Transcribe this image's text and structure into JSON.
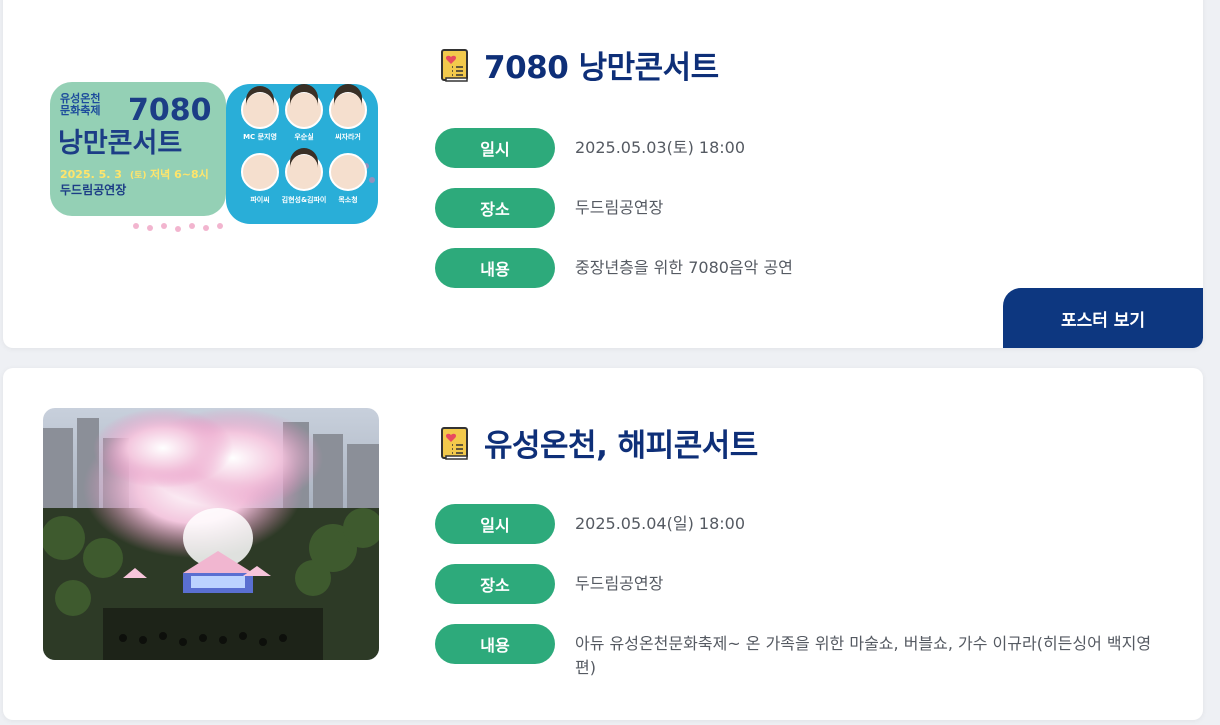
{
  "events": [
    {
      "title": "7080 낭만콘서트",
      "poster": {
        "festival": "유성온천\n문화축제",
        "number": "7080",
        "name": "낭만콘서트",
        "date": "2025. 5. 3",
        "day": "(토)",
        "time": "저녁 6~8시",
        "venue": "두드림공연장",
        "performers": [
          "MC 문지영",
          "우순실",
          "씨자라거",
          "파이씨",
          "김현성&김파이",
          "목소청"
        ]
      },
      "rows": [
        {
          "label": "일시",
          "value": "2025.05.03(토) 18:00"
        },
        {
          "label": "장소",
          "value": "두드림공연장"
        },
        {
          "label": "내용",
          "value": "중장년층을 위한 7080음악 공연"
        }
      ],
      "button": "포스터 보기"
    },
    {
      "title": "유성온천, 해피콘서트",
      "rows": [
        {
          "label": "일시",
          "value": "2025.05.04(일) 18:00"
        },
        {
          "label": "장소",
          "value": "두드림공연장"
        },
        {
          "label": "내용",
          "value": "아듀 유성온천문화축제~ 온 가족을 위한 마술쇼, 버블쇼, 가수 이규라(히든싱어 백지영편)"
        }
      ]
    }
  ],
  "colors": {
    "accent": "#2daa7b",
    "title": "#0e2f78",
    "button": "#0d3780"
  },
  "icons": [
    "book-heart-icon"
  ]
}
